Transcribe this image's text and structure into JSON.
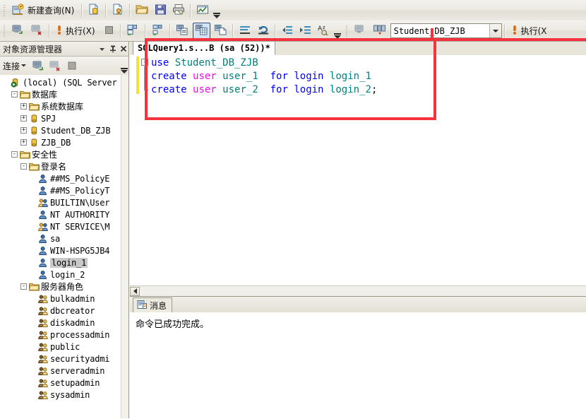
{
  "toolbar_main": {
    "new_query_label": "新建查询(N)",
    "buttons": [
      {
        "name": "new-query-button",
        "label": "新建查询(N)",
        "icon": "new-query-icon"
      },
      {
        "name": "new-database-engine-query-button",
        "label": "",
        "icon": "new-db-query-icon"
      },
      {
        "name": "new-analysis-services-query-button",
        "label": "",
        "icon": "new-analysis-query-icon"
      },
      {
        "name": "open-file-button",
        "label": "",
        "icon": "open-folder-icon"
      },
      {
        "name": "save-button",
        "label": "",
        "icon": "save-floppy-icon"
      },
      {
        "name": "print-button",
        "label": "",
        "icon": "printer-icon"
      },
      {
        "name": "activity-monitor-button",
        "label": "",
        "icon": "activity-monitor-icon"
      }
    ]
  },
  "toolbar_sql": {
    "execute_label": "执行(X)",
    "execute_label_2": "执行(X",
    "database_value": "Student_DB_ZJB",
    "database_placeholder": "Student_DB_ZJB",
    "buttons": [
      {
        "name": "connect-button",
        "icon": "connect-server-icon"
      },
      {
        "name": "disconnect-button",
        "icon": "disconnect-server-icon"
      },
      {
        "name": "execute-button",
        "icon": "execute-exclamation-icon"
      },
      {
        "name": "stop-button",
        "icon": "stop-square-icon"
      },
      {
        "name": "parse-button",
        "icon": "parse-checkmark-icon"
      },
      {
        "name": "display-estimated-plan-button",
        "icon": "estimated-plan-icon"
      },
      {
        "name": "results-to-text-button",
        "icon": "results-to-text-icon"
      },
      {
        "name": "results-to-grid-button",
        "icon": "results-to-grid-icon",
        "pressed": true
      },
      {
        "name": "results-to-file-button",
        "icon": "results-to-file-icon"
      },
      {
        "name": "comment-lines-button",
        "icon": "comment-lines-icon"
      },
      {
        "name": "uncomment-lines-button",
        "icon": "uncomment-lines-icon"
      },
      {
        "name": "decrease-indent-button",
        "icon": "decrease-indent-icon"
      },
      {
        "name": "increase-indent-button",
        "icon": "increase-indent-icon"
      },
      {
        "name": "spell-check-button",
        "icon": "spell-check-icon"
      }
    ]
  },
  "object_explorer": {
    "title": "对象资源管理器",
    "connect_label": "连接",
    "tree": [
      {
        "label": "(local) (SQL Server",
        "icon": "server-icon",
        "indent": 0,
        "expander": "",
        "selected": false,
        "cjk": false
      },
      {
        "label": "数据库",
        "icon": "folder-icon",
        "indent": 1,
        "expander": "-",
        "selected": false,
        "cjk": true
      },
      {
        "label": "系统数据库",
        "icon": "folder-icon",
        "indent": 2,
        "expander": "+",
        "selected": false,
        "cjk": true
      },
      {
        "label": "SPJ",
        "icon": "database-icon",
        "indent": 2,
        "expander": "+",
        "selected": false,
        "cjk": false
      },
      {
        "label": "Student_DB_ZJB",
        "icon": "database-icon",
        "indent": 2,
        "expander": "+",
        "selected": false,
        "cjk": false
      },
      {
        "label": "ZJB_DB",
        "icon": "database-icon",
        "indent": 2,
        "expander": "+",
        "selected": false,
        "cjk": false
      },
      {
        "label": "安全性",
        "icon": "folder-icon",
        "indent": 1,
        "expander": "-",
        "selected": false,
        "cjk": true
      },
      {
        "label": "登录名",
        "icon": "folder-icon",
        "indent": 2,
        "expander": "-",
        "selected": false,
        "cjk": true
      },
      {
        "label": "##MS_PolicyE",
        "icon": "login-icon",
        "indent": 3,
        "expander": "",
        "selected": false,
        "cjk": false
      },
      {
        "label": "##MS_PolicyT",
        "icon": "login-icon",
        "indent": 3,
        "expander": "",
        "selected": false,
        "cjk": false
      },
      {
        "label": "BUILTIN\\User",
        "icon": "login-group-icon",
        "indent": 3,
        "expander": "",
        "selected": false,
        "cjk": false
      },
      {
        "label": "NT AUTHORITY",
        "icon": "login-icon",
        "indent": 3,
        "expander": "",
        "selected": false,
        "cjk": false
      },
      {
        "label": "NT SERVICE\\M",
        "icon": "login-group-icon",
        "indent": 3,
        "expander": "",
        "selected": false,
        "cjk": false
      },
      {
        "label": "sa",
        "icon": "login-icon",
        "indent": 3,
        "expander": "",
        "selected": false,
        "cjk": false
      },
      {
        "label": "WIN-HSPG5JB4",
        "icon": "login-icon",
        "indent": 3,
        "expander": "",
        "selected": false,
        "cjk": false
      },
      {
        "label": "login_1",
        "icon": "login-icon",
        "indent": 3,
        "expander": "",
        "selected": true,
        "cjk": false
      },
      {
        "label": "login_2",
        "icon": "login-icon",
        "indent": 3,
        "expander": "",
        "selected": false,
        "cjk": false
      },
      {
        "label": "服务器角色",
        "icon": "folder-icon",
        "indent": 2,
        "expander": "-",
        "selected": false,
        "cjk": true
      },
      {
        "label": "bulkadmin",
        "icon": "role-icon",
        "indent": 3,
        "expander": "",
        "selected": false,
        "cjk": false
      },
      {
        "label": "dbcreator",
        "icon": "role-icon",
        "indent": 3,
        "expander": "",
        "selected": false,
        "cjk": false
      },
      {
        "label": "diskadmin",
        "icon": "role-icon",
        "indent": 3,
        "expander": "",
        "selected": false,
        "cjk": false
      },
      {
        "label": "processadmin",
        "icon": "role-icon",
        "indent": 3,
        "expander": "",
        "selected": false,
        "cjk": false
      },
      {
        "label": "public",
        "icon": "role-icon",
        "indent": 3,
        "expander": "",
        "selected": false,
        "cjk": false
      },
      {
        "label": "securityadmi",
        "icon": "role-icon",
        "indent": 3,
        "expander": "",
        "selected": false,
        "cjk": false
      },
      {
        "label": "serveradmin",
        "icon": "role-icon",
        "indent": 3,
        "expander": "",
        "selected": false,
        "cjk": false
      },
      {
        "label": "setupadmin",
        "icon": "role-icon",
        "indent": 3,
        "expander": "",
        "selected": false,
        "cjk": false
      },
      {
        "label": "sysadmin",
        "icon": "role-icon",
        "indent": 3,
        "expander": "",
        "selected": false,
        "cjk": false
      }
    ]
  },
  "editor": {
    "tab_title": "SQLQuery1.s...B (sa (52))*",
    "fold_marker": "-",
    "lines": [
      [
        {
          "t": "use ",
          "c": "k"
        },
        {
          "t": "Student_DB_ZJB",
          "c": "obj"
        }
      ],
      [
        {
          "t": "create ",
          "c": "k"
        },
        {
          "t": "user ",
          "c": "kw2"
        },
        {
          "t": "user_1 ",
          "c": "obj"
        },
        {
          "t": " for ",
          "c": "k"
        },
        {
          "t": "login ",
          "c": "k"
        },
        {
          "t": "login_1",
          "c": "obj"
        }
      ],
      [
        {
          "t": "create ",
          "c": "k"
        },
        {
          "t": "user ",
          "c": "kw2"
        },
        {
          "t": "user_2 ",
          "c": "obj"
        },
        {
          "t": " for ",
          "c": "k"
        },
        {
          "t": "login ",
          "c": "k"
        },
        {
          "t": "login_2",
          "c": "obj"
        },
        {
          "t": ";",
          "c": "pl"
        }
      ]
    ]
  },
  "results": {
    "tab_label": "消息",
    "message": "命令已成功完成。"
  },
  "colors": {
    "annotation_red": "#f5333f",
    "keyword_blue": "#0000ff",
    "keyword_magenta": "#ff00ff",
    "identifier_teal": "#008080",
    "changed_line_yellow": "#f2e32e",
    "selection_gray": "#c9c9c9",
    "toolbar_bg": "#ebe9e2"
  }
}
